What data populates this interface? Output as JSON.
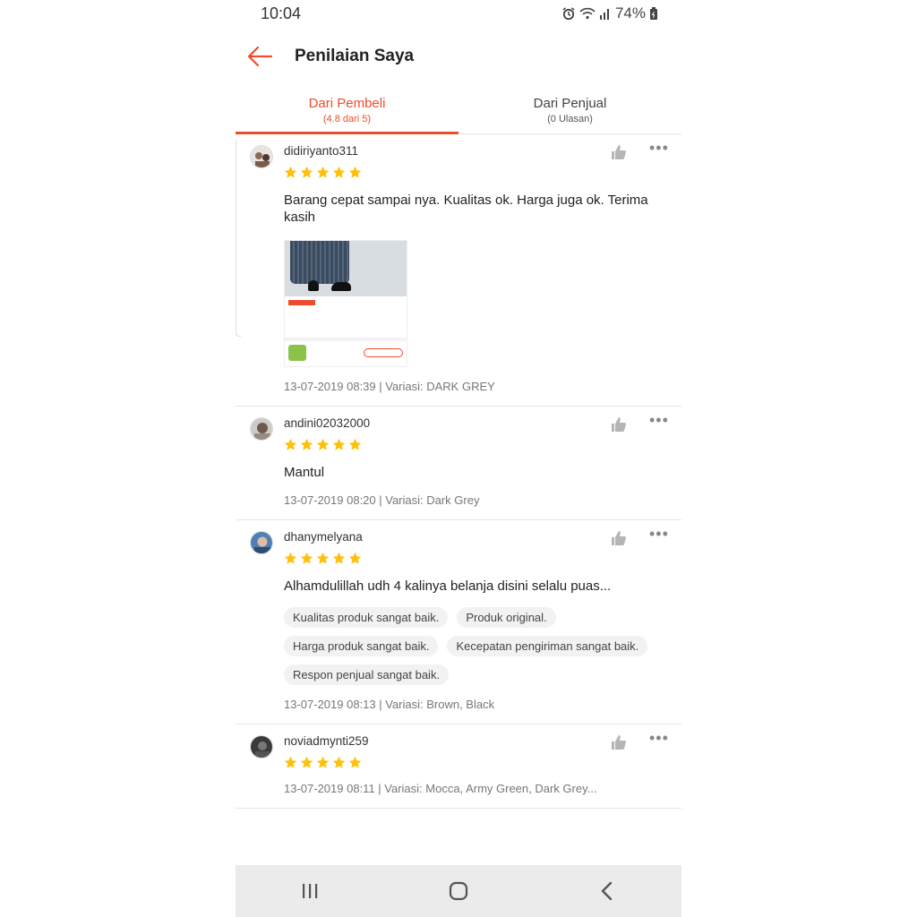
{
  "status_bar": {
    "time": "10:04",
    "battery": "74%",
    "icons": [
      "alarm-icon",
      "wifi-icon",
      "signal-icon",
      "battery-icon"
    ]
  },
  "header": {
    "title": "Penilaian Saya",
    "back_icon": "arrow-left-icon"
  },
  "colors": {
    "accent": "#ee4d2d",
    "star": "#ffc107"
  },
  "tabs": [
    {
      "label": "Dari Pembeli",
      "sub": "(4.8 dari 5)",
      "active": true
    },
    {
      "label": "Dari Penjual",
      "sub": "(0 Ulasan)",
      "active": false
    }
  ],
  "reviews": [
    {
      "username": "didiriyanto311",
      "rating": 5,
      "comment": "Barang cepat sampai nya. Kualitas ok. Harga juga ok.  Terima kasih",
      "meta": "13-07-2019 08:39 | Variasi: DARK GREY",
      "has_image": true
    },
    {
      "username": "andini02032000",
      "rating": 5,
      "comment": "Mantul",
      "meta": "13-07-2019 08:20 | Variasi: Dark Grey"
    },
    {
      "username": "dhanymelyana",
      "rating": 5,
      "comment": "Alhamdulillah udh 4 kalinya belanja disini selalu puas...",
      "tags": [
        "Kualitas produk sangat baik.",
        "Produk original.",
        "Harga produk sangat baik.",
        "Kecepatan pengiriman sangat baik.",
        "Respon penjual sangat baik."
      ],
      "meta": "13-07-2019 08:13 | Variasi: Brown, Black"
    },
    {
      "username": "noviadmynti259",
      "rating": 5,
      "meta": "13-07-2019 08:11 | Variasi: Mocca, Army Green, Dark Grey..."
    }
  ],
  "nav": {
    "recents_icon": "recent-apps-icon",
    "home_icon": "home-icon",
    "back_icon": "back-chevron-icon"
  }
}
